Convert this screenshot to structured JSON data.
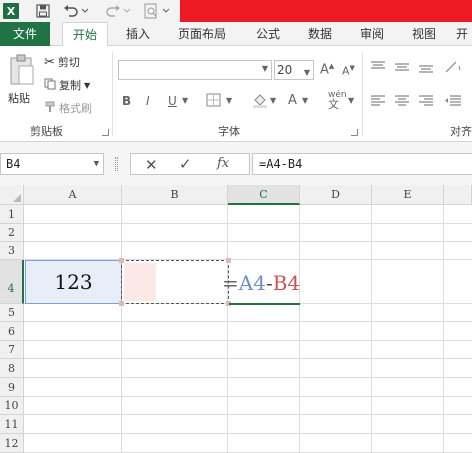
{
  "app": {
    "logo_text": "X"
  },
  "tabs": {
    "file": "文件",
    "home": "开始",
    "insert": "插入",
    "page_layout": "页面布局",
    "formulas": "公式",
    "data": "数据",
    "review": "审阅",
    "view": "视图",
    "more": "开"
  },
  "ribbon": {
    "clipboard": {
      "paste": "粘贴",
      "cut": "剪切",
      "copy": "复制",
      "format_painter": "格式刷",
      "group_label": "剪贴板"
    },
    "font": {
      "font_size": "20",
      "group_label": "字体",
      "bold": "B",
      "italic": "I",
      "underline": "U",
      "phonetic": "wén"
    },
    "alignment": {
      "group_label": "对齐"
    }
  },
  "formula_bar": {
    "name_box": "B4",
    "fx": "fx",
    "formula": "=A4-B4"
  },
  "grid": {
    "columns": [
      "A",
      "B",
      "C",
      "D",
      "E"
    ],
    "rows": [
      "1",
      "2",
      "3",
      "4",
      "5",
      "6",
      "7",
      "8",
      "9",
      "10",
      "11",
      "12"
    ],
    "selected_column": "C",
    "selected_row": "4",
    "cells": {
      "A4": "123"
    },
    "formula_overlay": {
      "eq": "=",
      "ref1": "A4",
      "minus": "-",
      "ref2": "B4"
    }
  },
  "colors": {
    "excel_green": "#217346",
    "ref1_color": "#6d8fc7",
    "ref2_color": "#c95450",
    "title_red": "#ec1a23"
  }
}
